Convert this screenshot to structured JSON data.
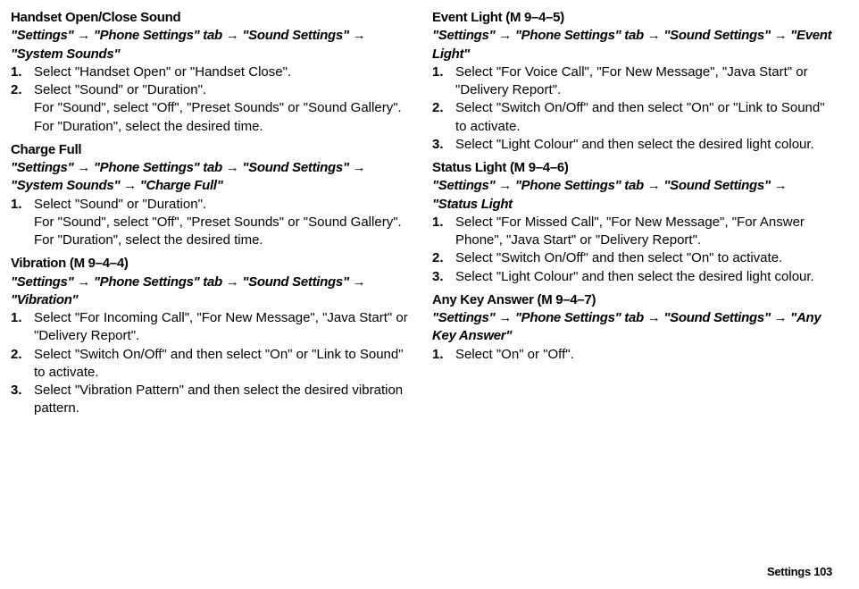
{
  "arrow": "→",
  "left": {
    "s1": {
      "title": "Handset Open/Close Sound",
      "path": "\"Settings\" → \"Phone Settings\" tab → \"Sound Settings\" → \"System Sounds\"",
      "steps": [
        {
          "n": "1.",
          "t": "Select \"Handset Open\" or \"Handset Close\"."
        },
        {
          "n": "2.",
          "t": "Select \"Sound\" or \"Duration\".",
          "sub1": "For \"Sound\", select \"Off\", \"Preset Sounds\" or \"Sound Gallery\".",
          "sub2": "For \"Duration\", select the desired time."
        }
      ]
    },
    "s2": {
      "title": "Charge Full",
      "path": "\"Settings\" → \"Phone Settings\" tab → \"Sound Settings\" → \"System Sounds\" → \"Charge Full\"",
      "steps": [
        {
          "n": "1.",
          "t": "Select \"Sound\" or \"Duration\".",
          "sub1": "For \"Sound\", select \"Off\", \"Preset Sounds\" or \"Sound Gallery\".",
          "sub2": "For \"Duration\", select the desired time."
        }
      ]
    },
    "s3": {
      "title": "Vibration",
      "code": "(M 9–4–4)",
      "path": "\"Settings\" → \"Phone Settings\" tab → \"Sound Settings\" → \"Vibration\"",
      "steps": [
        {
          "n": "1.",
          "t": "Select \"For Incoming Call\", \"For New Message\", \"Java Start\" or \"Delivery Report\"."
        },
        {
          "n": "2.",
          "t": "Select \"Switch On/Off\" and then select \"On\" or \"Link to Sound\" to activate."
        },
        {
          "n": "3.",
          "t": "Select \"Vibration Pattern\" and then select the desired vibration pattern."
        }
      ]
    }
  },
  "right": {
    "s4": {
      "title": "Event Light",
      "code": "(M 9–4–5)",
      "path": "\"Settings\" → \"Phone Settings\" tab → \"Sound Settings\" → \"Event Light\"",
      "steps": [
        {
          "n": "1.",
          "t": "Select \"For Voice Call\", \"For New Message\", \"Java Start\" or \"Delivery Report\"."
        },
        {
          "n": "2.",
          "t": "Select \"Switch On/Off\" and then select \"On\" or \"Link to Sound\" to activate."
        },
        {
          "n": "3.",
          "t": "Select \"Light Colour\" and then select the desired light colour."
        }
      ]
    },
    "s5": {
      "title": "Status Light",
      "code": "(M 9–4–6)",
      "path": "\"Settings\" → \"Phone Settings\" tab → \"Sound Settings\" → \"Status Light",
      "steps": [
        {
          "n": "1.",
          "t": "Select \"For Missed Call\", \"For New Message\", \"For Answer Phone\", \"Java Start\" or \"Delivery Report\"."
        },
        {
          "n": "2.",
          "t": "Select \"Switch On/Off\" and then select \"On\" to activate."
        },
        {
          "n": "3.",
          "t": "Select \"Light Colour\" and then select the desired light colour."
        }
      ]
    },
    "s6": {
      "title": "Any Key Answer",
      "code": "(M 9–4–7)",
      "path": "\"Settings\" → \"Phone Settings\" tab → \"Sound Settings\" → \"Any Key Answer\"",
      "steps": [
        {
          "n": "1.",
          "t": "Select \"On\" or \"Off\"."
        }
      ]
    }
  },
  "footer": "Settings   103"
}
